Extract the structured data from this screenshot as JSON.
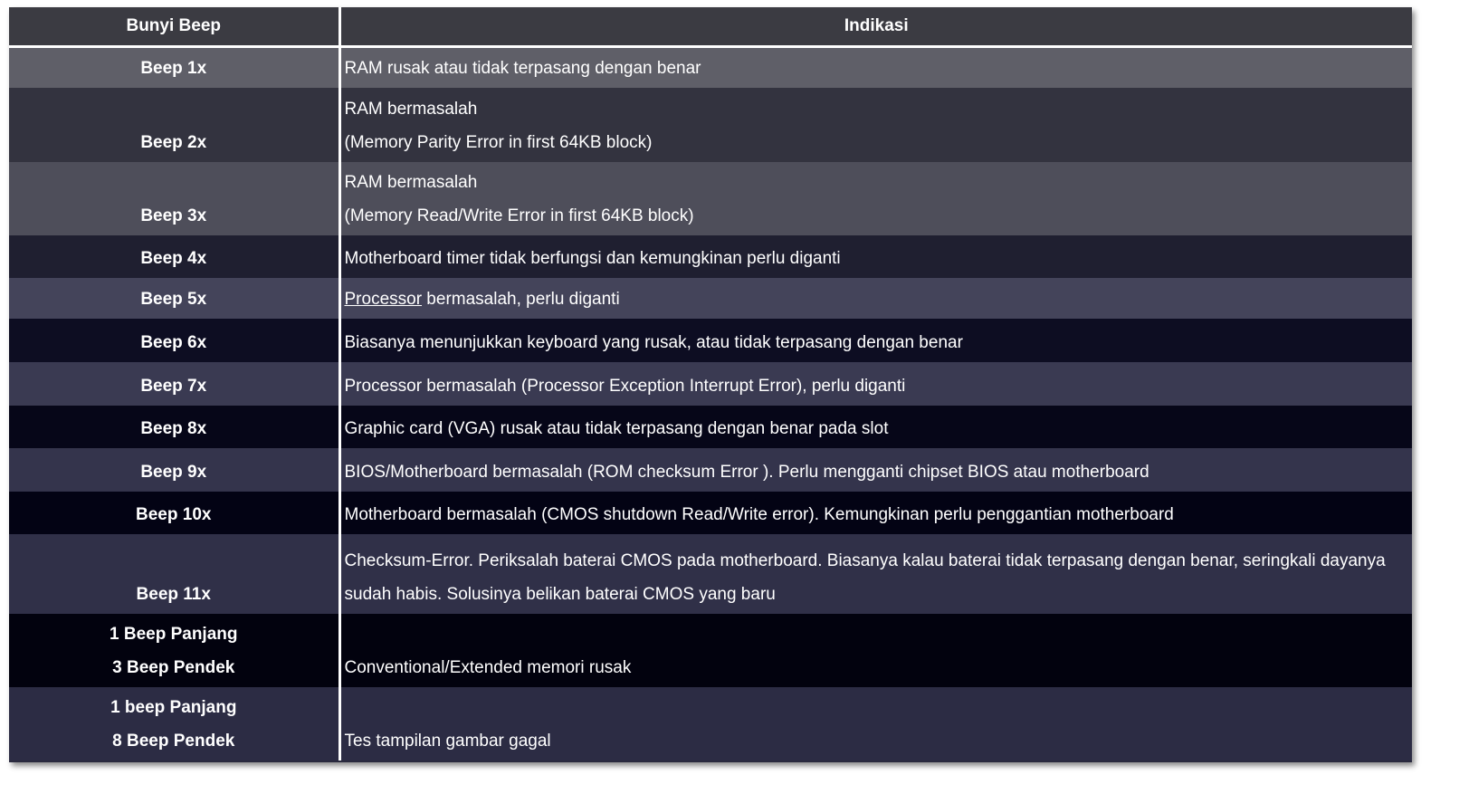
{
  "header": {
    "col1": "Bunyi Beep",
    "col2": "Indikasi"
  },
  "rows": [
    {
      "beep": [
        "Beep 1x"
      ],
      "indikasi": [
        "RAM rusak atau tidak terpasang dengan benar"
      ],
      "bg": "#5f5f68"
    },
    {
      "beep": [
        "Beep 2x"
      ],
      "indikasi": [
        "RAM bermasalah",
        "(Memory Parity Error in first 64KB block)"
      ],
      "bg": "#33333f"
    },
    {
      "beep": [
        "Beep 3x"
      ],
      "indikasi": [
        "RAM bermasalah",
        "(Memory Read/Write Error in first 64KB block)"
      ],
      "bg": "#4e4e5a"
    },
    {
      "beep": [
        "Beep 4x"
      ],
      "indikasi": [
        "Motherboard timer tidak berfungsi dan kemungkinan perlu diganti"
      ],
      "bg": "#1f1f30"
    },
    {
      "beep": [
        "Beep 5x"
      ],
      "indikasi_link": "Processor",
      "indikasi_rest": " bermasalah, perlu diganti",
      "bg": "#44445a"
    },
    {
      "beep": [
        "Beep 6x"
      ],
      "indikasi": [
        "Biasanya menunjukkan keyboard yang rusak, atau tidak terpasang dengan benar"
      ],
      "bg": "#0d0d22"
    },
    {
      "beep": [
        "Beep 7x"
      ],
      "indikasi": [
        "Processor bermasalah (Processor Exception Interrupt Error), perlu diganti"
      ],
      "bg": "#3a3a52"
    },
    {
      "beep": [
        "Beep 8x"
      ],
      "indikasi": [
        "Graphic card (VGA) rusak atau tidak terpasang dengan benar pada slot"
      ],
      "bg": "#060618"
    },
    {
      "beep": [
        "Beep 9x"
      ],
      "indikasi": [
        "BIOS/Motherboard bermasalah (ROM checksum Error ). Perlu mengganti chipset BIOS atau motherboard"
      ],
      "bg": "#34344c"
    },
    {
      "beep": [
        "Beep 10x"
      ],
      "indikasi": [
        "Motherboard bermasalah (CMOS shutdown Read/Write error). Kemungkinan perlu penggantian motherboard"
      ],
      "bg": "#030314"
    },
    {
      "beep": [
        "Beep 11x"
      ],
      "indikasi_para": "Checksum-Error. Periksalah baterai CMOS pada motherboard. Biasanya kalau baterai tidak terpasang dengan benar, seringkali dayanya sudah habis. Solusinya belikan baterai CMOS yang baru",
      "bg": "#303048"
    },
    {
      "beep": [
        "1 Beep Panjang",
        "3 Beep Pendek"
      ],
      "indikasi": [
        "Conventional/Extended memori rusak"
      ],
      "bg": "#02020e"
    },
    {
      "beep": [
        "1 beep Panjang",
        "8 Beep Pendek"
      ],
      "indikasi": [
        "Tes tampilan gambar gagal"
      ],
      "bg": "#2c2c44"
    }
  ]
}
